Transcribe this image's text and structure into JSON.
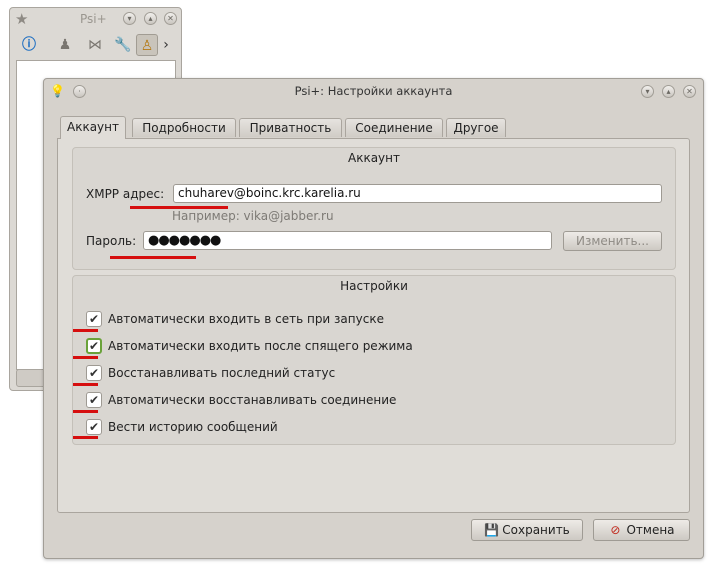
{
  "background_window": {
    "title": "Psi+",
    "icons": [
      "star-icon",
      "info-icon",
      "contacts-icon",
      "service-discovery-icon",
      "wrench-icon",
      "person-icon"
    ]
  },
  "dialog": {
    "title": "Psi+: Настройки аккаунта",
    "tabs": [
      {
        "label": "Аккаунт",
        "active": true
      },
      {
        "label": "Подробности",
        "active": false
      },
      {
        "label": "Приватность",
        "active": false
      },
      {
        "label": "Соединение",
        "active": false
      },
      {
        "label": "Другое",
        "active": false
      }
    ],
    "account_group": {
      "title": "Аккаунт",
      "xmpp_label": "XMPP адрес:",
      "xmpp_value": "chuharev@boinc.krc.karelia.ru",
      "xmpp_hint": "Например: vika@jabber.ru",
      "password_label": "Пароль:",
      "password_value": "●●●●●●●",
      "change_button": "Изменить..."
    },
    "settings_group": {
      "title": "Настройки",
      "options": [
        {
          "label": "Автоматически входить в сеть при запуске",
          "checked": true
        },
        {
          "label": "Автоматически входить после спящего режима",
          "checked": true,
          "focused": true
        },
        {
          "label": "Восстанавливать последний статус",
          "checked": true
        },
        {
          "label": "Автоматически восстанавливать соединение",
          "checked": true
        },
        {
          "label": "Вести историю сообщений",
          "checked": true
        }
      ]
    },
    "buttons": {
      "save": "Сохранить",
      "cancel": "Отмена"
    }
  },
  "colors": {
    "annotation_red": "#d60f0f",
    "focus_green": "#6aa23a"
  }
}
